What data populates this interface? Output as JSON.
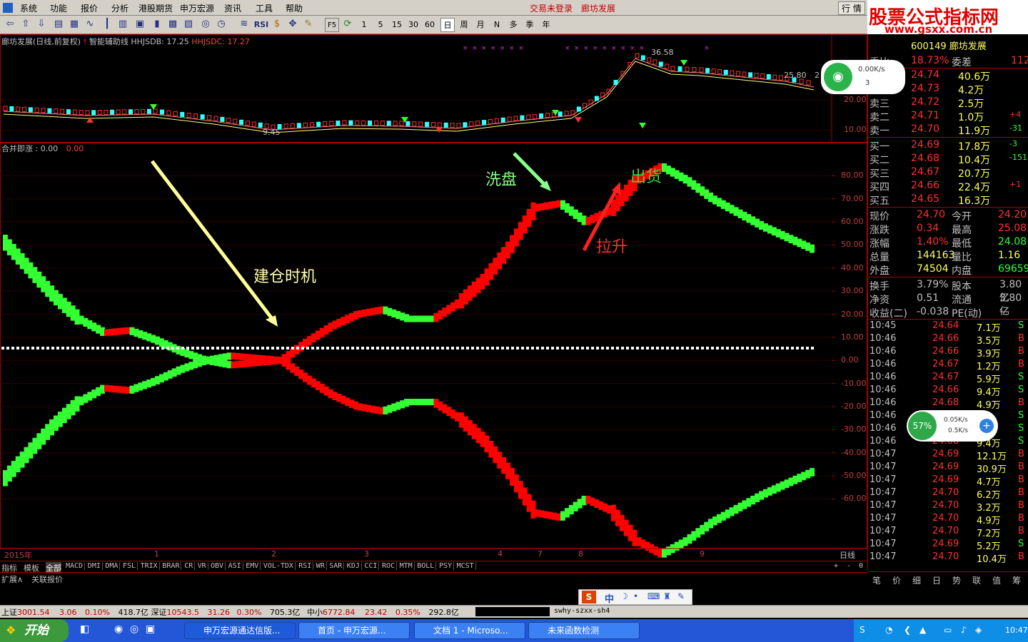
{
  "menu": {
    "items": [
      "系统",
      "功能",
      "报价",
      "分析",
      "港股期货",
      "申万宏源",
      "资讯",
      "工具",
      "帮助"
    ],
    "alerts": [
      "交易未登录",
      "廊坊发展"
    ],
    "right": [
      "行",
      "情"
    ]
  },
  "brand": {
    "title": "股票公式指标网",
    "url": "www.gsxx.com.cn"
  },
  "toolbar": {
    "periods": [
      "1",
      "5",
      "15",
      "30",
      "60",
      "日",
      "周",
      "月",
      "N",
      "多",
      "季",
      "年"
    ],
    "labels": [
      "RSI",
      "F5"
    ]
  },
  "main_chart": {
    "title": "廊坊发展(日线,前复权)",
    "aux_label": "智能辅助线",
    "hhjsdb": "HHJSDB: 17.25",
    "hhjsdc": "HHJSDC: 17.27",
    "high_label": "36.58",
    "low_label": "9.45",
    "right_label": "25.80",
    "right_label_cut": "2",
    "y_ticks": [
      "20.00",
      "10.00"
    ]
  },
  "indicator": {
    "name": "合并即涨",
    "value1": ": 0.00",
    "value2": "0.00",
    "y_ticks": [
      "80.00",
      "70.00",
      "60.00",
      "50.00",
      "40.00",
      "30.00",
      "20.00",
      "10.00",
      "0.00",
      "-10.00",
      "-20.00",
      "-30.00",
      "-40.00",
      "-50.00",
      "-60.00"
    ],
    "annotations": {
      "build": "建仓时机",
      "wash": "洗盘",
      "ship": "出货",
      "lift": "拉升"
    }
  },
  "chart_data": {
    "type": "line",
    "ylim": [
      -75,
      90
    ],
    "series": [
      {
        "values": [
          52,
          40,
          28,
          18,
          12,
          13,
          9,
          4,
          0,
          -2,
          -1,
          0,
          8,
          15,
          20,
          22,
          18,
          18,
          25,
          35,
          49,
          66,
          68,
          60,
          65,
          78,
          84,
          78,
          70,
          64,
          58,
          53,
          48
        ]
      },
      {
        "values": [
          -52,
          -40,
          -28,
          -18,
          -12,
          -13,
          -9,
          -4,
          0,
          2,
          1,
          0,
          -8,
          -15,
          -20,
          -22,
          -18,
          -18,
          -25,
          -35,
          -49,
          -66,
          -68,
          -60,
          -65,
          -78,
          -84,
          -78,
          -70,
          -64,
          -58,
          -53,
          -48
        ]
      }
    ]
  },
  "time_axis": {
    "year": "2015年",
    "months": [
      "1",
      "2",
      "3",
      "4",
      "7",
      "8",
      "9"
    ],
    "period": "日线"
  },
  "tabs": {
    "left": [
      "指标",
      "模板",
      "全部"
    ],
    "indicators": [
      "MACD",
      "DMI",
      "DMA",
      "FSL",
      "TRIX",
      "BRAR",
      "CR",
      "VR",
      "OBV",
      "ASI",
      "EMV",
      "VOL-TDX",
      "RSI",
      "WR",
      "SAR",
      "KDJ",
      "CCI",
      "ROC",
      "MTM",
      "BOLL",
      "PSY",
      "MCST"
    ],
    "controls": [
      "+",
      "-",
      "0"
    ],
    "ext": [
      "扩展",
      "关联报价"
    ]
  },
  "quote": {
    "code": "600149",
    "name": "廊坊发展",
    "wb_label": "委比",
    "wb_value": "18.73%",
    "wc_label": "委差",
    "wc_value": "112",
    "asks": [
      {
        "label": "卖五",
        "price": "24.74",
        "vol": "40.6万",
        "chg": ""
      },
      {
        "label": "卖四",
        "price": "24.73",
        "vol": "4.2万",
        "chg": ""
      },
      {
        "label": "卖三",
        "price": "24.72",
        "vol": "2.5万",
        "chg": ""
      },
      {
        "label": "卖二",
        "price": "24.71",
        "vol": "1.0万",
        "chg": "+4"
      },
      {
        "label": "卖一",
        "price": "24.70",
        "vol": "11.9万",
        "chg": "-31"
      }
    ],
    "bids": [
      {
        "label": "买一",
        "price": "24.69",
        "vol": "17.8万",
        "chg": "-3"
      },
      {
        "label": "买二",
        "price": "24.68",
        "vol": "10.4万",
        "chg": "-151"
      },
      {
        "label": "买三",
        "price": "24.67",
        "vol": "20.7万",
        "chg": ""
      },
      {
        "label": "买四",
        "price": "24.66",
        "vol": "22.4万",
        "chg": "+1"
      },
      {
        "label": "买五",
        "price": "24.65",
        "vol": "16.3万",
        "chg": ""
      }
    ],
    "stats": [
      {
        "l1": "现价",
        "v1": "24.70",
        "l2": "今开",
        "v2": "24.20"
      },
      {
        "l1": "涨跌",
        "v1": "0.34",
        "l2": "最高",
        "v2": "25.08"
      },
      {
        "l1": "涨幅",
        "v1": "1.40%",
        "l2": "最低",
        "v2": "24.08"
      },
      {
        "l1": "总量",
        "v1": "144163",
        "l2": "量比",
        "v2": "1.16"
      },
      {
        "l1": "外盘",
        "v1": "74504",
        "l2": "内盘",
        "v2": "69659"
      }
    ],
    "stats2": [
      {
        "l1": "换手",
        "v1": "3.79%",
        "l2": "股本",
        "v2": "3.80亿"
      },
      {
        "l1": "净资",
        "v1": "0.51",
        "l2": "流通",
        "v2": "3.80亿"
      },
      {
        "l1": "收益(二)",
        "v1": "-0.038",
        "l2": "PE(动)",
        "v2": "—"
      }
    ],
    "ticks": [
      {
        "t": "10:45",
        "p": "24.64",
        "v": "7.1万",
        "s": "S"
      },
      {
        "t": "10:46",
        "p": "24.66",
        "v": "3.5万",
        "s": "B"
      },
      {
        "t": "10:46",
        "p": "24.66",
        "v": "3.9万",
        "s": "B"
      },
      {
        "t": "10:46",
        "p": "24.67",
        "v": "1.2万",
        "s": "B"
      },
      {
        "t": "10:46",
        "p": "24.67",
        "v": "5.9万",
        "s": "S"
      },
      {
        "t": "10:46",
        "p": "24.66",
        "v": "9.4万",
        "s": "S"
      },
      {
        "t": "10:46",
        "p": "24.68",
        "v": "4.9万",
        "s": "B"
      },
      {
        "t": "10:46",
        "p": "",
        "v": "7万",
        "s": "S"
      },
      {
        "t": "10:46",
        "p": "",
        "v": "万",
        "s": "S"
      },
      {
        "t": "10:46",
        "p": "24.68",
        "v": "9.4万",
        "s": "S"
      },
      {
        "t": "10:47",
        "p": "24.69",
        "v": "12.1万",
        "s": "B"
      },
      {
        "t": "10:47",
        "p": "24.69",
        "v": "30.9万",
        "s": "B"
      },
      {
        "t": "10:47",
        "p": "24.69",
        "v": "4.7万",
        "s": "B"
      },
      {
        "t": "10:47",
        "p": "24.70",
        "v": "6.2万",
        "s": "B"
      },
      {
        "t": "10:47",
        "p": "24.70",
        "v": "3.2万",
        "s": "B"
      },
      {
        "t": "10:47",
        "p": "24.70",
        "v": "4.9万",
        "s": "B"
      },
      {
        "t": "10:47",
        "p": "24.70",
        "v": "7.2万",
        "s": "B"
      },
      {
        "t": "10:47",
        "p": "24.69",
        "v": "5.2万",
        "s": "S"
      },
      {
        "t": "10:47",
        "p": "24.70",
        "v": "10.4万",
        "s": "B"
      }
    ],
    "bottom_tabs": [
      "笔",
      "价",
      "细",
      "日",
      "势",
      "联",
      "值",
      "筹"
    ]
  },
  "net_widget": {
    "speed": "0.00K/s",
    "count": "3"
  },
  "mem_widget": {
    "percent": "57%",
    "up": "0.05K/s",
    "down": "0.5K/s"
  },
  "ime": {
    "label": "中"
  },
  "status": {
    "sh_label": "上证",
    "sh_idx": "3001.54",
    "sh_chg": "3.06",
    "sh_pct": "0.10%",
    "sh_amt": "418.7亿",
    "sz_label": "深证",
    "sz_idx": "10543.5",
    "sz_chg": "31.26",
    "sz_pct": "0.30%",
    "sz_amt": "705.3亿",
    "zx_label": "中小",
    "zx_idx": "6772.84",
    "zx_chg": "23.42",
    "zx_pct": "0.35%",
    "zx_amt": "292.8亿",
    "server": "swhy-szxx-sh4"
  },
  "taskbar": {
    "start": "开始",
    "tasks": [
      "申万宏源通达信版...",
      "首页 - 申万宏源...",
      "文档 1 - Microso...",
      "未来函数检测"
    ],
    "clock": "10:47"
  },
  "colors": {
    "red": "#ff0000",
    "green": "#33ff33",
    "grid": "#a00000",
    "yellow": "#ffff80"
  }
}
